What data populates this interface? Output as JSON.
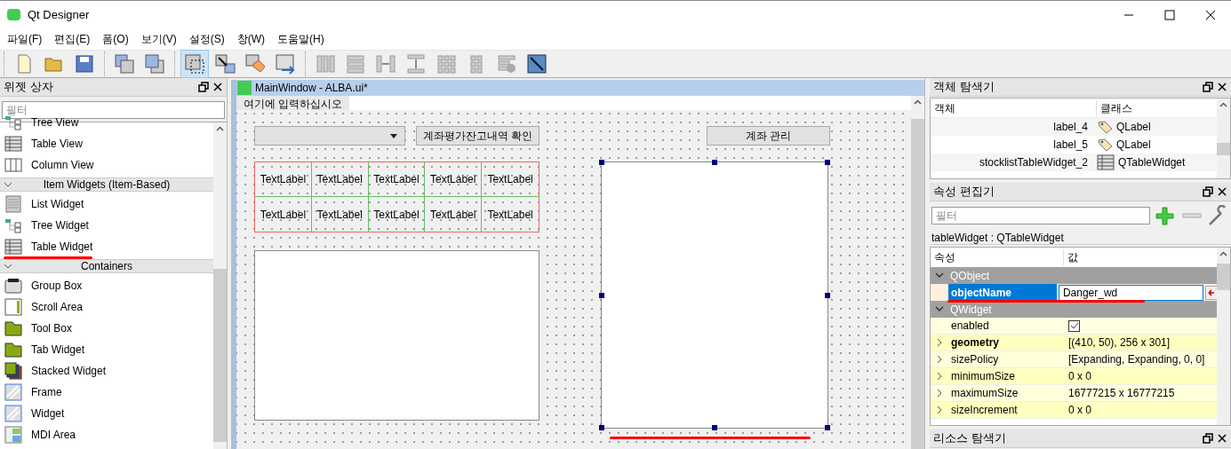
{
  "window": {
    "title": "Qt Designer"
  },
  "menu": [
    "파일(F)",
    "편집(E)",
    "폼(O)",
    "보기(V)",
    "설정(S)",
    "창(W)",
    "도움말(H)"
  ],
  "toolbar": [
    {
      "kind": "new",
      "selected": false
    },
    {
      "kind": "open",
      "selected": false
    },
    {
      "kind": "save",
      "selected": false
    },
    {
      "kind": "sep"
    },
    {
      "kind": "back",
      "selected": false
    },
    {
      "kind": "front",
      "selected": false
    },
    {
      "kind": "sep"
    },
    {
      "kind": "edit-widgets",
      "selected": true
    },
    {
      "kind": "signals",
      "selected": false
    },
    {
      "kind": "buddies",
      "selected": false
    },
    {
      "kind": "tab-order",
      "selected": false
    },
    {
      "kind": "sep"
    },
    {
      "kind": "hlayout",
      "selected": false
    },
    {
      "kind": "vlayout",
      "selected": false
    },
    {
      "kind": "hsplit",
      "selected": false
    },
    {
      "kind": "vsplit",
      "selected": false
    },
    {
      "kind": "grid",
      "selected": false
    },
    {
      "kind": "form",
      "selected": false
    },
    {
      "kind": "break",
      "selected": false
    },
    {
      "kind": "adjust",
      "selected": false
    }
  ],
  "widget_box": {
    "title": "위젯 상자",
    "filter": {
      "placeholder": "필터"
    },
    "items": [
      {
        "kind": "item",
        "label": "Tree View"
      },
      {
        "kind": "item",
        "label": "Table View"
      },
      {
        "kind": "item",
        "label": "Column View"
      },
      {
        "kind": "category",
        "label": "Item Widgets (Item-Based)",
        "expanded": true
      },
      {
        "kind": "item",
        "label": "List Widget"
      },
      {
        "kind": "item",
        "label": "Tree Widget"
      },
      {
        "kind": "item",
        "label": "Table Widget",
        "underlined": true
      },
      {
        "kind": "category",
        "label": "Containers",
        "expanded": true
      },
      {
        "kind": "item",
        "label": "Group Box"
      },
      {
        "kind": "item",
        "label": "Scroll Area"
      },
      {
        "kind": "item",
        "label": "Tool Box"
      },
      {
        "kind": "item",
        "label": "Tab Widget"
      },
      {
        "kind": "item",
        "label": "Stacked Widget"
      },
      {
        "kind": "item",
        "label": "Frame"
      },
      {
        "kind": "item",
        "label": "Widget"
      },
      {
        "kind": "item",
        "label": "MDI Area"
      }
    ]
  },
  "form": {
    "title": "MainWindow - ALBA.ui*",
    "menu_placeholder": "여기에 입력하십시오",
    "buttons": [
      "계좌평가잔고내역 확인",
      "계좌 관리"
    ],
    "labels": [
      [
        "TextLabel",
        "TextLabel",
        "TextLabel",
        "TextLabel",
        "TextLabel"
      ],
      [
        "TextLabel",
        "TextLabel",
        "TextLabel",
        "TextLabel",
        "TextLabel"
      ]
    ]
  },
  "object_inspector": {
    "title": "객체 탐색기",
    "columns": [
      "객체",
      "클래스"
    ],
    "rows": [
      {
        "object": "label_4",
        "class": "QLabel"
      },
      {
        "object": "label_5",
        "class": "QLabel"
      },
      {
        "object": "stocklistTableWidget_2",
        "class": "QTableWidget"
      }
    ]
  },
  "property_editor": {
    "title": "속성 편집기",
    "filter": {
      "placeholder": "필터"
    },
    "object": "tableWidget : QTableWidget",
    "columns": [
      "속성",
      "값"
    ],
    "rows": [
      {
        "kind": "group",
        "name": "QObject"
      },
      {
        "kind": "edit",
        "name": "objectName",
        "value": "Danger_wd"
      },
      {
        "kind": "group",
        "name": "QWidget"
      },
      {
        "kind": "check",
        "name": "enabled",
        "checked": true
      },
      {
        "kind": "prop",
        "name": "geometry",
        "value": "[(410, 50), 256 x 301]",
        "bold": true
      },
      {
        "kind": "prop",
        "name": "sizePolicy",
        "value": "[Expanding, Expanding, 0, 0]",
        "bold": false
      },
      {
        "kind": "prop",
        "name": "minimumSize",
        "value": "0 x 0",
        "bold": false
      },
      {
        "kind": "prop",
        "name": "maximumSize",
        "value": "16777215 x 16777215",
        "bold": false
      },
      {
        "kind": "prop",
        "name": "sizeIncrement",
        "value": "0 x 0",
        "bold": false
      }
    ]
  },
  "resource_browser": {
    "title": "리소스 탐색기"
  }
}
